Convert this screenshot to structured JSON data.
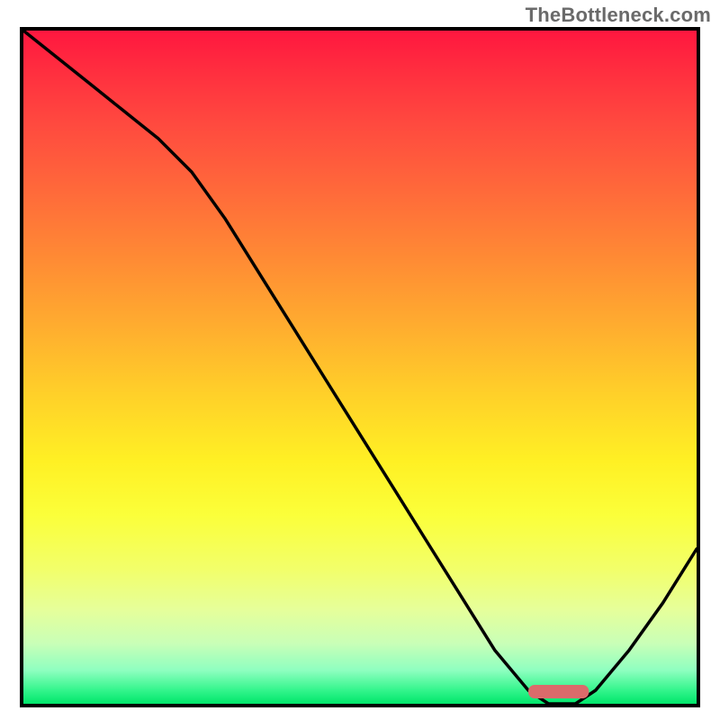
{
  "watermark": "TheBottleneck.com",
  "chart_data": {
    "type": "line",
    "title": "",
    "xlabel": "",
    "ylabel": "",
    "xlim": [
      0,
      100
    ],
    "ylim": [
      0,
      100
    ],
    "x": [
      0,
      5,
      10,
      15,
      20,
      25,
      30,
      35,
      40,
      45,
      50,
      55,
      60,
      65,
      70,
      75,
      78,
      82,
      85,
      90,
      95,
      100
    ],
    "values": [
      100,
      96,
      92,
      88,
      84,
      79,
      72,
      64,
      56,
      48,
      40,
      32,
      24,
      16,
      8,
      2,
      0,
      0,
      2,
      8,
      15,
      23
    ],
    "optimum_band_x": [
      75,
      84
    ],
    "colors": {
      "top": "#ff173f",
      "mid": "#ffd029",
      "bottom": "#00e56a",
      "marker": "#db6b6b",
      "line": "#000000"
    }
  }
}
